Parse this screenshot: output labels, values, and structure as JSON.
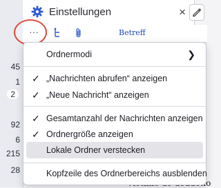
{
  "tab": {
    "title": "Einstellungen",
    "close_glyph": "×",
    "icon": "gear-icon",
    "accent": "#2f5ad1"
  },
  "folder_counts": [
    "45",
    "1",
    "2",
    "92",
    "6",
    "215",
    "28"
  ],
  "column_header": {
    "more_label": "···",
    "subject_label": "Betreff"
  },
  "annotation": {
    "color": "#e04a3b"
  },
  "background_peek_text": "Victime de deductio",
  "menu": {
    "items": [
      {
        "label": "Ordnermodi",
        "checked": false,
        "submenu": true
      },
      {
        "label": "„Nachrichten abrufen“ anzeigen",
        "checked": true
      },
      {
        "label": "„Neue Nachricht“ anzeigen",
        "checked": true
      },
      {
        "label": "Gesamtanzahl der Nachrichten anzeigen",
        "checked": true
      },
      {
        "label": "Ordnergröße anzeigen",
        "checked": true
      },
      {
        "label": "Lokale Ordner verstecken",
        "checked": false,
        "hovered": true
      },
      {
        "label": "Kopfzeile des Ordnerbereichs ausblenden",
        "checked": false
      }
    ],
    "check_glyph": "✓",
    "chevron_glyph": "❯"
  }
}
